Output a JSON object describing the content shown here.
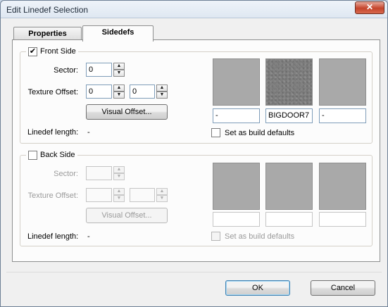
{
  "window": {
    "title": "Edit Linedef Selection",
    "close_glyph": "✕"
  },
  "tabs": [
    {
      "label": "Properties"
    },
    {
      "label": "Sidedefs"
    }
  ],
  "front": {
    "legend": "Front Side",
    "checked": true,
    "sector_label": "Sector:",
    "sector_value": "0",
    "offset_label": "Texture Offset:",
    "offset_x": "0",
    "offset_y": "0",
    "visual_offset": "Visual Offset...",
    "length_label": "Linedef length:",
    "length_value": "-",
    "textures": [
      "-",
      "BIGDOOR7",
      "-"
    ],
    "build_defaults": "Set as build defaults"
  },
  "back": {
    "legend": "Back Side",
    "checked": false,
    "sector_label": "Sector:",
    "sector_value": "",
    "offset_label": "Texture Offset:",
    "offset_x": "",
    "offset_y": "",
    "visual_offset": "Visual Offset...",
    "length_label": "Linedef length:",
    "length_value": "-",
    "textures": [
      "",
      "",
      ""
    ],
    "build_defaults": "Set as build defaults"
  },
  "footer": {
    "ok": "OK",
    "cancel": "Cancel"
  },
  "icons": {
    "check": "✔",
    "spin_up": "▲",
    "spin_down": "▼"
  }
}
